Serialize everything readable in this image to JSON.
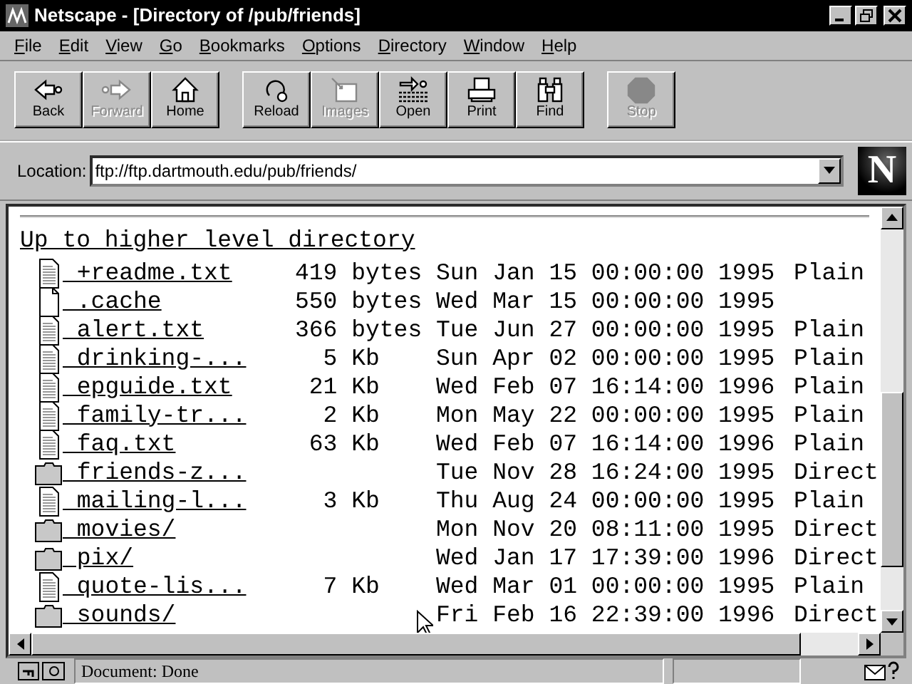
{
  "window": {
    "title": "Netscape - [Directory of /pub/friends]"
  },
  "menu": [
    "File",
    "Edit",
    "View",
    "Go",
    "Bookmarks",
    "Options",
    "Directory",
    "Window",
    "Help"
  ],
  "toolbar": [
    [
      {
        "label": "Back",
        "kind": "back",
        "disabled": false
      },
      {
        "label": "Forward",
        "kind": "forward",
        "disabled": true
      },
      {
        "label": "Home",
        "kind": "home",
        "disabled": false
      }
    ],
    [
      {
        "label": "Reload",
        "kind": "reload",
        "disabled": false
      },
      {
        "label": "Images",
        "kind": "images",
        "disabled": true
      },
      {
        "label": "Open",
        "kind": "open",
        "disabled": false
      },
      {
        "label": "Print",
        "kind": "print",
        "disabled": false
      },
      {
        "label": "Find",
        "kind": "find",
        "disabled": false
      }
    ],
    [
      {
        "label": "Stop",
        "kind": "stop",
        "disabled": true
      }
    ]
  ],
  "location": {
    "label": "Location:",
    "value": "ftp://ftp.dartmouth.edu/pub/friends/"
  },
  "logo": {
    "letter": "N"
  },
  "listing": {
    "parent_link": "Up to higher level directory",
    "rows": [
      {
        "kind": "text",
        "name": " +readme.txt",
        "size": "419 bytes",
        "date": "Sun Jan 15 00:00:00 1995",
        "type": "Plain"
      },
      {
        "kind": "file",
        "name": " .cache",
        "size": "550 bytes",
        "date": "Wed Mar 15 00:00:00 1995"
      },
      {
        "kind": "text",
        "name": " alert.txt",
        "size": "366 bytes",
        "date": "Tue Jun 27 00:00:00 1995",
        "type": "Plain"
      },
      {
        "kind": "text",
        "name": " drinking-...",
        "size": "5 Kb",
        "date": "Sun Apr 02 00:00:00 1995",
        "type": "Plain"
      },
      {
        "kind": "text",
        "name": " epguide.txt",
        "size": "21 Kb",
        "date": "Wed Feb 07 16:14:00 1996",
        "type": "Plain"
      },
      {
        "kind": "text",
        "name": " family-tr...",
        "size": "2 Kb",
        "date": "Mon May 22 00:00:00 1995",
        "type": "Plain"
      },
      {
        "kind": "text",
        "name": " faq.txt",
        "size": "63 Kb",
        "date": "Wed Feb 07 16:14:00 1996",
        "type": "Plain"
      },
      {
        "kind": "folder",
        "name": " friends-z...",
        "date": "Tue Nov 28 16:24:00 1995",
        "type": "Direct"
      },
      {
        "kind": "text",
        "name": " mailing-l...",
        "size": "3 Kb",
        "date": "Thu Aug 24 00:00:00 1995",
        "type": "Plain"
      },
      {
        "kind": "folder",
        "name": " movies/",
        "date": "Mon Nov 20 08:11:00 1995",
        "type": "Direct"
      },
      {
        "kind": "folder",
        "name": " pix/",
        "date": "Wed Jan 17 17:39:00 1996",
        "type": "Direct"
      },
      {
        "kind": "text",
        "name": " quote-lis...",
        "size": "7 Kb",
        "date": "Wed Mar 01 00:00:00 1995",
        "type": "Plain"
      },
      {
        "kind": "folder",
        "name": " sounds/",
        "date": "Fri Feb 16 22:39:00 1996",
        "type": "Direct"
      }
    ]
  },
  "status_bar": {
    "text": "Document: Done"
  }
}
